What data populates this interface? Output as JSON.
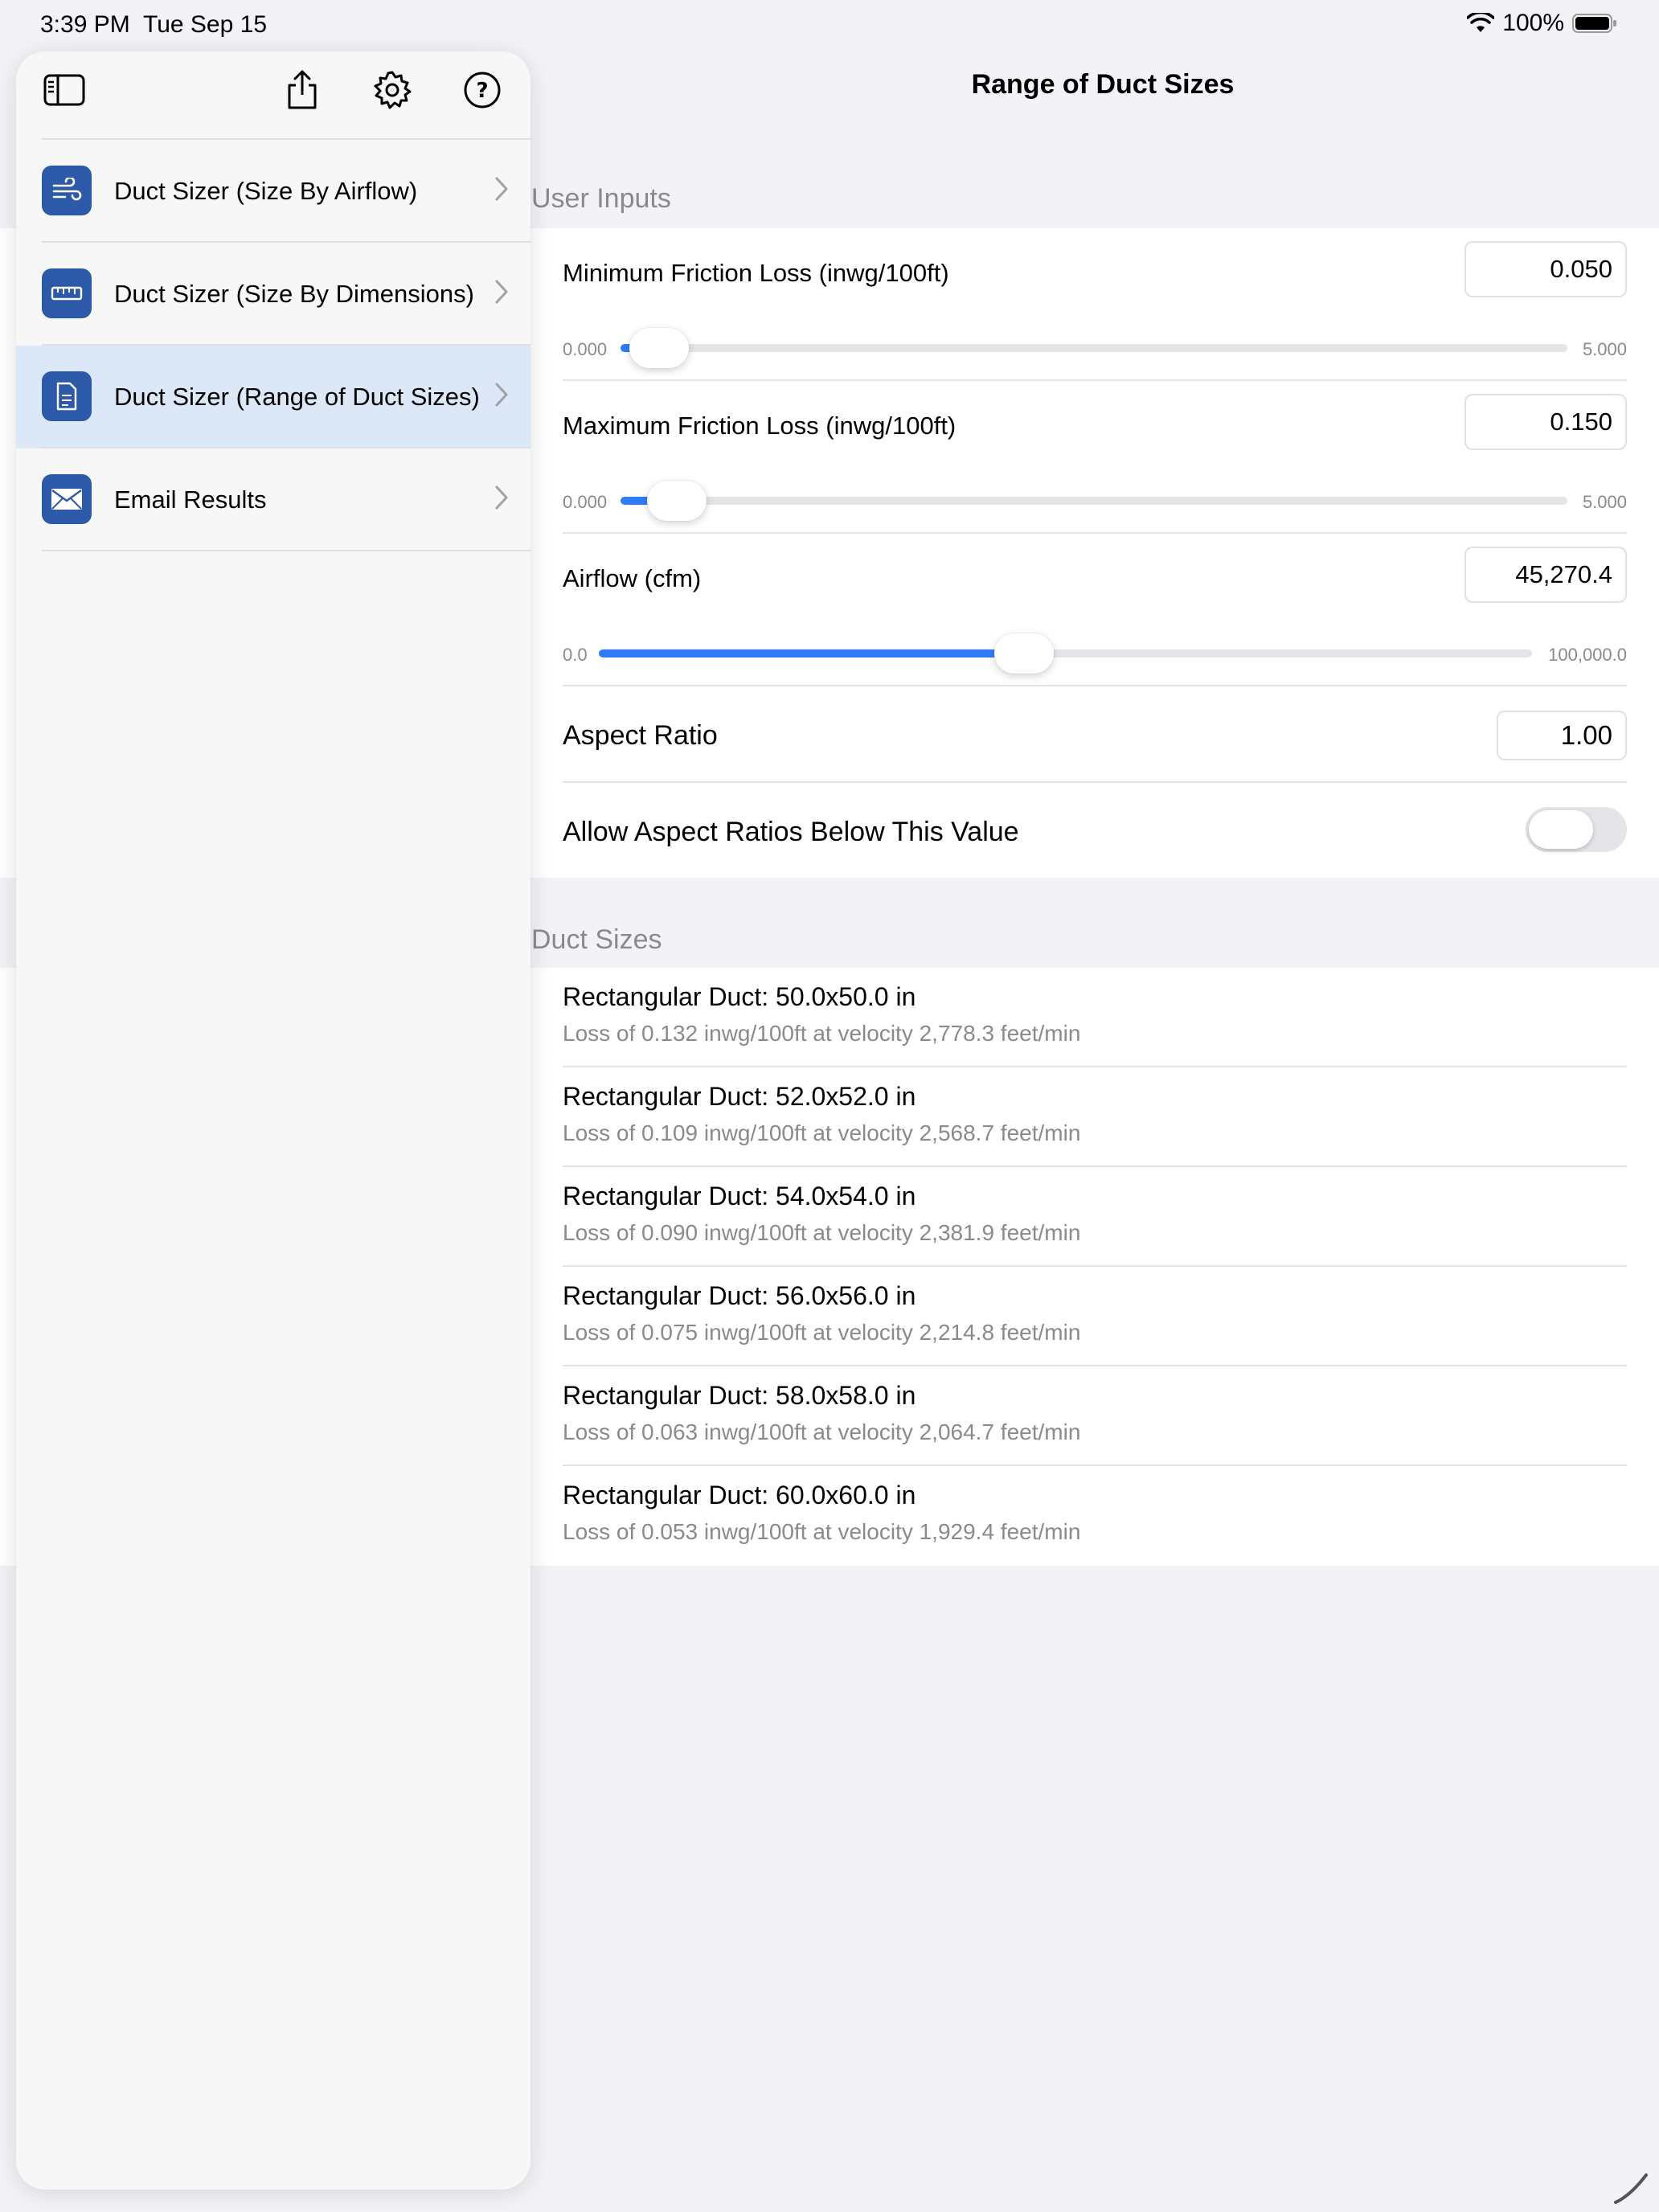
{
  "status": {
    "time": "3:39 PM",
    "date": "Tue Sep 15",
    "battery": "100%"
  },
  "nav": {
    "title": "Range of Duct Sizes"
  },
  "sidebar": {
    "toolbar": [
      "sidebar-toggle-icon",
      "share-icon",
      "gear-icon",
      "help-icon"
    ],
    "items": [
      {
        "label": "Duct Sizer (Size By Airflow)",
        "icon": "airflow-icon"
      },
      {
        "label": "Duct Sizer (Size By Dimensions)",
        "icon": "ruler-icon"
      },
      {
        "label": "Duct Sizer (Range of Duct Sizes)",
        "icon": "document-icon",
        "selected": true
      },
      {
        "label": "Email Results",
        "icon": "envelope-icon"
      }
    ]
  },
  "inputs": {
    "header": "User Inputs",
    "min_friction": {
      "label": "Minimum Friction Loss (inwg/100ft)",
      "value": "0.050",
      "min": "0.000",
      "max": "5.000",
      "fraction": 0.01
    },
    "max_friction": {
      "label": "Maximum Friction Loss (inwg/100ft)",
      "value": "0.150",
      "min": "0.000",
      "max": "5.000",
      "fraction": 0.03
    },
    "airflow": {
      "label": "Airflow (cfm)",
      "value": "45,270.4",
      "min": "0.0",
      "max": "100,000.0",
      "fraction": 0.4527
    },
    "aspect_ratio": {
      "label": "Aspect Ratio",
      "value": "1.00"
    },
    "allow_below": {
      "label": "Allow Aspect Ratios Below This Value",
      "on": false
    }
  },
  "results": {
    "header": "Duct Sizes",
    "items": [
      {
        "title": "Rectangular Duct: 50.0x50.0 in",
        "detail": "Loss of 0.132 inwg/100ft at velocity 2,778.3 feet/min"
      },
      {
        "title": "Rectangular Duct: 52.0x52.0 in",
        "detail": "Loss of 0.109 inwg/100ft at velocity 2,568.7 feet/min"
      },
      {
        "title": "Rectangular Duct: 54.0x54.0 in",
        "detail": "Loss of 0.090 inwg/100ft at velocity 2,381.9 feet/min"
      },
      {
        "title": "Rectangular Duct: 56.0x56.0 in",
        "detail": "Loss of 0.075 inwg/100ft at velocity 2,214.8 feet/min"
      },
      {
        "title": "Rectangular Duct: 58.0x58.0 in",
        "detail": "Loss of 0.063 inwg/100ft at velocity 2,064.7 feet/min"
      },
      {
        "title": "Rectangular Duct: 60.0x60.0 in",
        "detail": "Loss of 0.053 inwg/100ft at velocity 1,929.4 feet/min"
      }
    ]
  },
  "colors": {
    "accent": "#2f7df6",
    "icon_bg": "#2d5aa8",
    "selected_bg": "#dce8f8"
  }
}
